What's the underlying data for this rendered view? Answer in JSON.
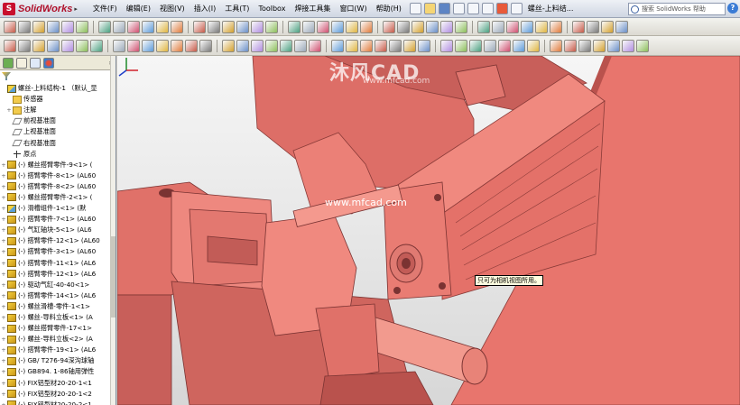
{
  "app": {
    "logo_text": "SolidWorks",
    "logo_mark": "S"
  },
  "menu": [
    {
      "label": "文件(F)"
    },
    {
      "label": "编辑(E)"
    },
    {
      "label": "视图(V)"
    },
    {
      "label": "插入(I)"
    },
    {
      "label": "工具(T)"
    },
    {
      "label": "Toolbox"
    },
    {
      "label": "焊接工具集"
    },
    {
      "label": "窗口(W)"
    },
    {
      "label": "帮助(H)"
    }
  ],
  "document_title": "螺丝-上料结...",
  "search": {
    "placeholder": "搜索 SolidWorks 帮助"
  },
  "help_icon_label": "?",
  "tree": {
    "items": [
      {
        "label": "螺丝-上料结构-1 （默认_显",
        "icon": "assembly-icon",
        "expand": ""
      },
      {
        "label": "传感器",
        "icon": "sensor-folder-icon",
        "expand": ""
      },
      {
        "label": "注解",
        "icon": "annotation-folder-icon",
        "expand": "+"
      },
      {
        "label": "前视基准面",
        "icon": "plane-icon",
        "expand": ""
      },
      {
        "label": "上视基准面",
        "icon": "plane-icon",
        "expand": ""
      },
      {
        "label": "右视基准面",
        "icon": "plane-icon",
        "expand": ""
      },
      {
        "label": "原点",
        "icon": "origin-icon",
        "expand": ""
      },
      {
        "label": "(-) 螺丝搭臂零件-9<1> (",
        "icon": "part-icon",
        "expand": "+"
      },
      {
        "label": "(-) 搭臂零件-8<1> (AL60",
        "icon": "part-icon",
        "expand": "+"
      },
      {
        "label": "(-) 搭臂零件-8<2> (AL60",
        "icon": "part-icon",
        "expand": "+"
      },
      {
        "label": "(-) 螺丝搭臂零件-2<1> (",
        "icon": "part-icon",
        "expand": "+"
      },
      {
        "label": "(-) 滑槽组件-1<1> (默",
        "icon": "subassembly-icon",
        "expand": "+"
      },
      {
        "label": "(-) 搭臂零件-7<1> (AL60",
        "icon": "part-icon",
        "expand": "+"
      },
      {
        "label": "(-) 气缸轴块-5<1> (AL6",
        "icon": "part-icon",
        "expand": "+"
      },
      {
        "label": "(-) 搭臂零件-12<1> (AL60",
        "icon": "part-icon",
        "expand": "+"
      },
      {
        "label": "(-) 搭臂零件-3<1> (AL60",
        "icon": "part-icon",
        "expand": "+"
      },
      {
        "label": "(-) 搭臂零件-11<1> (AL6",
        "icon": "part-icon",
        "expand": "+"
      },
      {
        "label": "(-) 搭臂零件-12<1> (AL6",
        "icon": "part-icon",
        "expand": "+"
      },
      {
        "label": "(-) 驱动气缸-40-40<1>",
        "icon": "part-icon",
        "expand": "+"
      },
      {
        "label": "(-) 搭臂零件-14<1> (AL6",
        "icon": "part-icon",
        "expand": "+"
      },
      {
        "label": "(-) 螺丝滑槽-零件-1<1>",
        "icon": "part-icon",
        "expand": "+"
      },
      {
        "label": "(-) 螺丝-导料立板<1> (A",
        "icon": "part-icon",
        "expand": "+"
      },
      {
        "label": "(-) 螺丝搭臂零件-17<1>",
        "icon": "part-icon",
        "expand": "+"
      },
      {
        "label": "(-) 螺丝-导料立板<2> (A",
        "icon": "part-icon",
        "expand": "+"
      },
      {
        "label": "(-) 搭臂零件-19<1> (AL6",
        "icon": "part-icon",
        "expand": "+"
      },
      {
        "label": "(-) GB/ T276-94深沟球轴",
        "icon": "part-icon",
        "expand": "+"
      },
      {
        "label": "(-) GB894. 1-86轴用弹性",
        "icon": "part-icon",
        "expand": "+"
      },
      {
        "label": "(-) FIX铝型材20-20-1<1",
        "icon": "part-icon",
        "expand": "+"
      },
      {
        "label": "(-) FIX铝型材20-20-1<2",
        "icon": "part-icon",
        "expand": "+"
      },
      {
        "label": "(-) FIX铝型材20-20-2<1",
        "icon": "part-icon",
        "expand": "+"
      }
    ]
  },
  "viewport": {
    "tooltip": "只可为相机视图所用。",
    "watermark": "沐风CAD",
    "watermark_url": "www.mfcad.com",
    "center_url": "www.mfcad.com"
  },
  "colors": {
    "model": "#e8796f",
    "model_shadow": "#a94c48",
    "model_light": "#f29a8e",
    "model_dark": "#7a3332"
  }
}
